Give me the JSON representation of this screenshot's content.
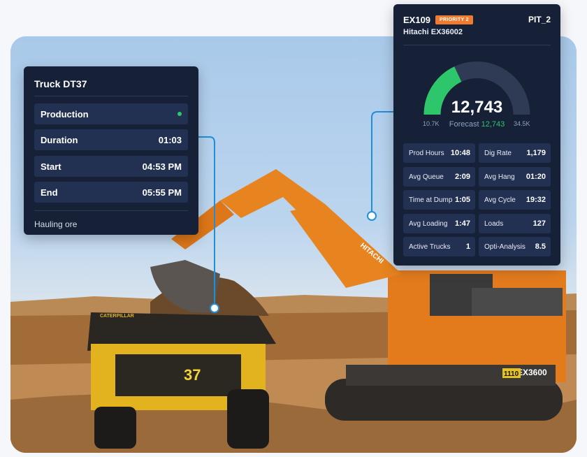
{
  "truck_card": {
    "title": "Truck DT37",
    "rows": [
      {
        "label": "Production",
        "value": ""
      },
      {
        "label": "Duration",
        "value": "01:03"
      },
      {
        "label": "Start",
        "value": "04:53 PM"
      },
      {
        "label": "End",
        "value": "05:55 PM"
      }
    ],
    "status_color": "#2ec66a",
    "footer": "Hauling ore"
  },
  "excavator_card": {
    "id": "EX109",
    "priority": "PRIORITY 2",
    "pit": "PIT_2",
    "model": "Hitachi EX36002",
    "gauge": {
      "value_text": "12,743",
      "value": 12743,
      "min": 10700,
      "max": 34500,
      "min_label": "10.7K",
      "max_label": "34.5K",
      "forecast_label": "Forecast",
      "forecast_value": "12,743",
      "fill_color": "#2ec66a",
      "track_color": "#2f3b55"
    },
    "stats": [
      {
        "label": "Prod Hours",
        "value": "10:48"
      },
      {
        "label": "Dig Rate",
        "value": "1,179"
      },
      {
        "label": "Avg Queue",
        "value": "2:09"
      },
      {
        "label": "Avg Hang",
        "value": "01:20"
      },
      {
        "label": "Time at Dump",
        "value": "1:05"
      },
      {
        "label": "Avg Cycle",
        "value": "19:32"
      },
      {
        "label": "Avg Loading",
        "value": "1:47"
      },
      {
        "label": "Loads",
        "value": "127"
      },
      {
        "label": "Active Trucks",
        "value": "1"
      },
      {
        "label": "Opti-Analysis",
        "value": "8.5"
      }
    ]
  },
  "scene": {
    "truck_number": "37",
    "truck_brand": "CATERPILLAR",
    "excavator_brand": "HITACHI",
    "excavator_model": "EX3600",
    "excavator_number": "1110",
    "accent_color": "#1f8fd6"
  }
}
